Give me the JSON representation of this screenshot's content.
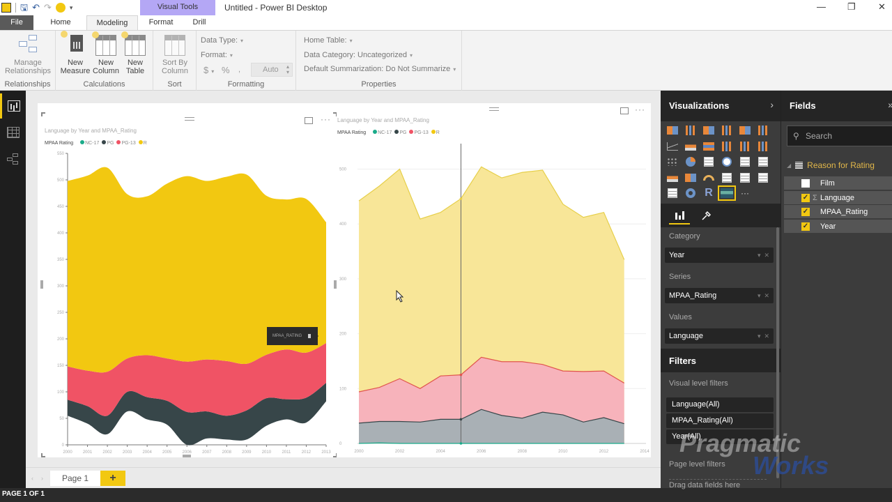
{
  "window": {
    "title": "Untitled - Power BI Desktop",
    "contextual_tab_group": "Visual Tools",
    "controls": {
      "minimize": "—",
      "restore": "❐",
      "close": "✕"
    }
  },
  "quick_access": {
    "icons": [
      "powerbi-logo",
      "save-icon",
      "undo-icon",
      "redo-icon",
      "smiley-feedback-icon",
      "customize-qat-icon"
    ]
  },
  "ribbon": {
    "tabs": [
      {
        "label": "File"
      },
      {
        "label": "Home"
      },
      {
        "label": "Modeling",
        "active": true
      },
      {
        "label": "Format"
      },
      {
        "label": "Drill"
      }
    ],
    "groups": {
      "relationships": {
        "label": "Relationships",
        "buttons": [
          {
            "label": "Manage Relationships"
          }
        ]
      },
      "calculations": {
        "label": "Calculations",
        "buttons": [
          {
            "label": "New Measure"
          },
          {
            "label": "New Column"
          },
          {
            "label": "New Table"
          }
        ]
      },
      "sort": {
        "label": "Sort",
        "buttons": [
          {
            "label": "Sort By Column"
          }
        ]
      },
      "formatting": {
        "label": "Formatting",
        "data_type": "Data Type:",
        "format": "Format:",
        "currency": "$",
        "percent": "%",
        "comma": "̩",
        "decimal_value": "Auto"
      },
      "properties": {
        "label": "Properties",
        "home_table": "Home Table:",
        "data_category": "Data Category: Uncategorized",
        "default_summarization": "Default Summarization: Do Not Summarize"
      }
    }
  },
  "left_nav": [
    {
      "name": "report-view",
      "active": true
    },
    {
      "name": "data-view",
      "active": false
    },
    {
      "name": "relationships-view",
      "active": false
    }
  ],
  "visuals": [
    {
      "title": "Language by Year and MPAA_Rating",
      "legend_title": "MPAA Rating",
      "tooltip": "MPAA_RATING"
    },
    {
      "title": "Language by Year and MPAA_Rating",
      "legend_title": "MPAA Rating"
    }
  ],
  "chart_data": [
    {
      "type": "area",
      "subtype": "streamgraph",
      "title": "Language by Year and MPAA_Rating",
      "legend_title": "MPAA Rating",
      "legend_position": "top-left",
      "xlabel": "",
      "ylabel": "",
      "x": [
        2000,
        2001,
        2002,
        2003,
        2004,
        2005,
        2006,
        2007,
        2008,
        2009,
        2010,
        2011,
        2012,
        2013
      ],
      "xticks": [
        "2000",
        "2001",
        "2002",
        "2003",
        "2004",
        "2005",
        "2006",
        "2007",
        "2008",
        "2009",
        "2010",
        "2011",
        "2012",
        "2013"
      ],
      "ylim": [
        0,
        550
      ],
      "yticks": [
        0,
        50,
        100,
        150,
        200,
        250,
        300,
        350,
        400,
        450,
        500,
        550
      ],
      "baseline": [
        55,
        40,
        20,
        63,
        48,
        38,
        0,
        12,
        10,
        10,
        36,
        48,
        42,
        82
      ],
      "series": [
        {
          "name": "NC-17",
          "color": "#1aab8a",
          "values": [
            0,
            0,
            0,
            0,
            0,
            0,
            0,
            0,
            0,
            0,
            0,
            0,
            0,
            0
          ]
        },
        {
          "name": "PG",
          "color": "#374649",
          "values": [
            30,
            33,
            35,
            37,
            42,
            45,
            62,
            51,
            45,
            55,
            52,
            38,
            47,
            35
          ]
        },
        {
          "name": "PG-13",
          "color": "#f05365",
          "values": [
            63,
            67,
            83,
            63,
            79,
            80,
            95,
            98,
            103,
            88,
            82,
            94,
            85,
            75
          ]
        },
        {
          "name": "R",
          "color": "#f2c811",
          "values": [
            350,
            368,
            385,
            310,
            300,
            330,
            350,
            337,
            348,
            357,
            300,
            283,
            290,
            228
          ]
        }
      ]
    },
    {
      "type": "area",
      "subtype": "stacked",
      "title": "Language by Year and MPAA_Rating",
      "legend_title": "MPAA Rating",
      "legend_position": "top-left",
      "xlabel": "",
      "ylabel": "",
      "x": [
        2000,
        2001,
        2002,
        2003,
        2004,
        2005,
        2006,
        2007,
        2008,
        2009,
        2010,
        2011,
        2012,
        2013
      ],
      "xlim": [
        2000,
        2014
      ],
      "xticks": [
        "2000",
        "2002",
        "2004",
        "2006",
        "2008",
        "2010",
        "2012",
        "2014"
      ],
      "ylim": [
        0,
        540
      ],
      "yticks": [
        0,
        100,
        200,
        300,
        400,
        500
      ],
      "grid": true,
      "highlight_x": 2005,
      "series": [
        {
          "name": "NC-17",
          "color": "#1aab8a",
          "values": [
            0,
            1,
            0,
            0,
            0,
            0,
            0,
            0,
            0,
            0,
            0,
            0,
            0,
            0
          ]
        },
        {
          "name": "PG",
          "color": "#374649",
          "values": [
            37,
            39,
            40,
            39,
            44,
            44,
            62,
            51,
            46,
            57,
            52,
            39,
            47,
            36
          ]
        },
        {
          "name": "PG-13",
          "color": "#f05365",
          "values": [
            57,
            62,
            78,
            61,
            79,
            81,
            95,
            98,
            103,
            87,
            80,
            92,
            85,
            74
          ]
        },
        {
          "name": "R",
          "color": "#f2c811",
          "values": [
            348,
            367,
            382,
            309,
            298,
            321,
            347,
            335,
            345,
            354,
            304,
            281,
            289,
            225
          ]
        }
      ]
    }
  ],
  "page_tabs": {
    "pages": [
      {
        "label": "Page 1",
        "active": true
      }
    ],
    "add_label": "+"
  },
  "status_bar": {
    "text": "PAGE 1 OF 1"
  },
  "visualizations_pane": {
    "title": "Visualizations",
    "icons": [
      "stacked-bar-chart",
      "stacked-column-chart",
      "clustered-bar-chart",
      "clustered-column-chart",
      "100-stacked-bar-chart",
      "100-stacked-column-chart",
      "line-chart",
      "area-chart",
      "stacked-area-chart",
      "line-and-stacked-column-chart",
      "line-and-clustered-column-chart",
      "waterfall-chart",
      "scatter-chart",
      "pie-chart",
      "treemap",
      "map",
      "table",
      "matrix",
      "filled-map",
      "funnel",
      "gauge",
      "multi-row-card",
      "card",
      "kpi",
      "slicer",
      "donut-chart",
      "r-visual",
      "streamgraph-custom-visual",
      "more-visuals"
    ],
    "selected_icon": "streamgraph-custom-visual",
    "tabs": [
      {
        "name": "fields-tab",
        "active": true
      },
      {
        "name": "format-tab",
        "active": false
      }
    ],
    "wells": [
      {
        "label": "Category",
        "field": "Year"
      },
      {
        "label": "Series",
        "field": "MPAA_Rating"
      },
      {
        "label": "Values",
        "field": "Language"
      }
    ]
  },
  "filters_pane": {
    "title": "Filters",
    "visual_level_label": "Visual level filters",
    "visual_filters": [
      "Language(All)",
      "MPAA_Rating(All)",
      "Year(All)"
    ],
    "page_level_label": "Page level filters",
    "drop_hint": "Drag data fields here"
  },
  "fields_pane": {
    "title": "Fields",
    "search_placeholder": "Search",
    "table": "Reason for Rating",
    "fields": [
      {
        "name": "Film",
        "checked": false,
        "aggregate": false
      },
      {
        "name": "Language",
        "checked": true,
        "aggregate": true
      },
      {
        "name": "MPAA_Rating",
        "checked": true,
        "aggregate": false
      },
      {
        "name": "Year",
        "checked": true,
        "aggregate": false
      }
    ]
  },
  "watermark": {
    "line1": "Pragmatic",
    "line2": "Works"
  }
}
